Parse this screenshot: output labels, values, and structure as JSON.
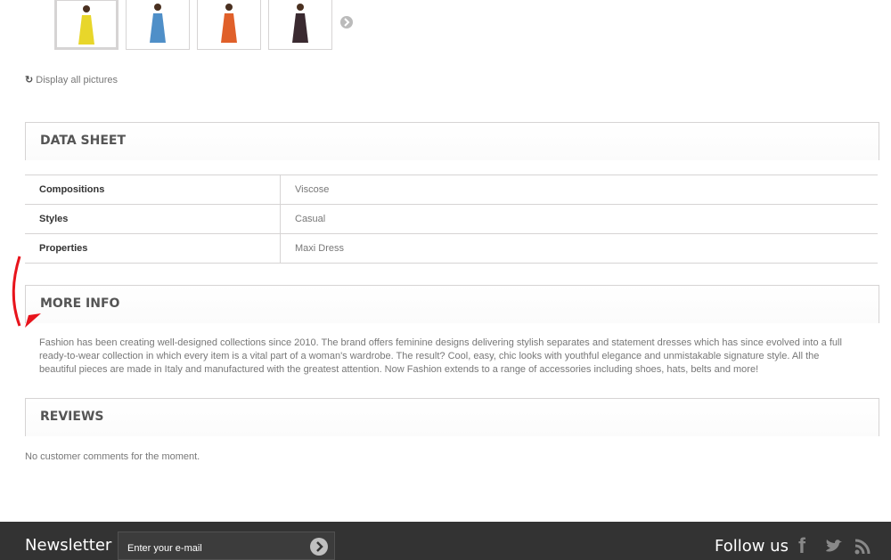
{
  "gallery": {
    "thumbnails": [
      {
        "dress_color": "#e8d62a"
      },
      {
        "dress_color": "#4f8fc8"
      },
      {
        "dress_color": "#e0602a"
      },
      {
        "dress_color": "#3a2a30"
      }
    ],
    "display_all": "Display all pictures"
  },
  "data_sheet": {
    "title": "DATA SHEET",
    "rows": [
      {
        "key": "Compositions",
        "value": "Viscose"
      },
      {
        "key": "Styles",
        "value": "Casual"
      },
      {
        "key": "Properties",
        "value": "Maxi Dress"
      }
    ]
  },
  "more_info": {
    "title": "MORE INFO",
    "text": "Fashion has been creating well-designed collections since 2010. The brand offers feminine designs delivering stylish separates and statement dresses which has since evolved into a full ready-to-wear collection in which every item is a vital part of a woman's wardrobe. The result? Cool, easy, chic looks with youthful elegance and unmistakable signature style. All the beautiful pieces are made in Italy and manufactured with the greatest attention. Now Fashion extends to a range of accessories including shoes, hats, belts and more!"
  },
  "reviews": {
    "title": "REVIEWS",
    "empty": "No customer comments for the moment."
  },
  "footer": {
    "newsletter": "Newsletter",
    "email_placeholder": "Enter your e-mail",
    "follow": "Follow us"
  }
}
